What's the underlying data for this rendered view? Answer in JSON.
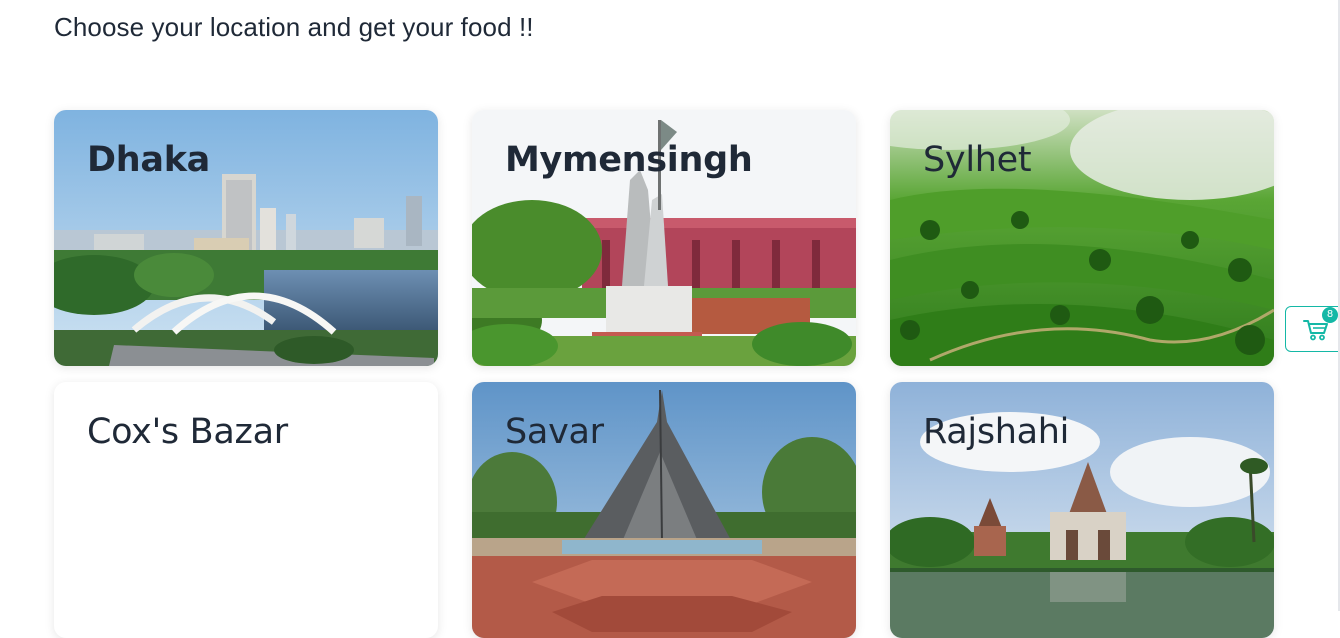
{
  "page": {
    "heading": "Choose your location and get your food !!"
  },
  "locations": [
    {
      "name": "Dhaka"
    },
    {
      "name": "Mymensingh"
    },
    {
      "name": "Sylhet"
    },
    {
      "name": "Cox's Bazar"
    },
    {
      "name": "Savar"
    },
    {
      "name": "Rajshahi"
    }
  ],
  "cart": {
    "count": "8",
    "icon": "shopping-cart-icon",
    "accent_color": "#14b8a6"
  }
}
